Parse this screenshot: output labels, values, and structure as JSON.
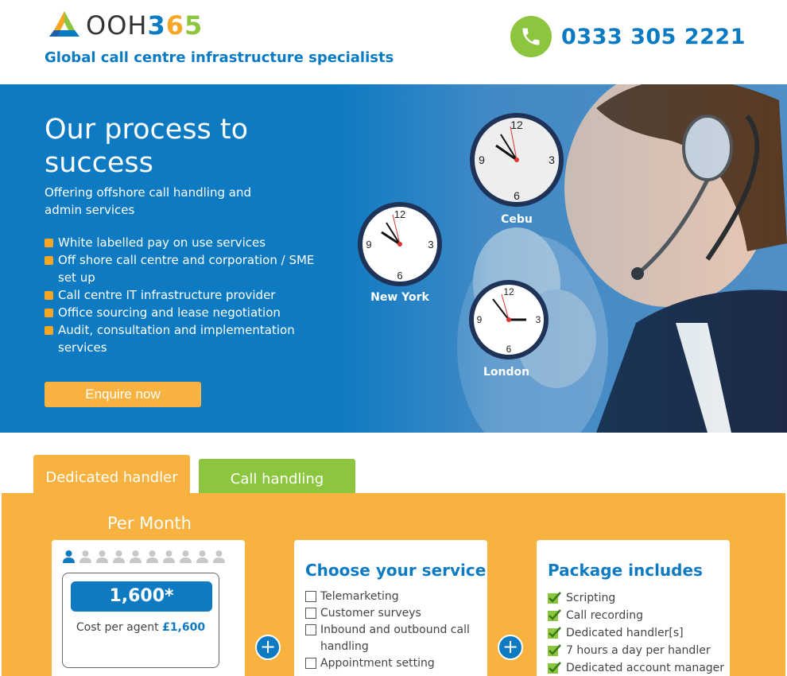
{
  "header": {
    "logo_text_a": "OOH",
    "logo_text_b": "3",
    "logo_text_c": "6",
    "logo_text_d": "5",
    "tagline": "Global call centre infrastructure specialists",
    "phone_icon": "phone-icon",
    "phone_number": "0333 305 2221"
  },
  "hero": {
    "title": "Our process to success",
    "subtitle": "Offering offshore call handling and admin services",
    "bullets": [
      "White labelled pay on use services",
      "Off shore call centre and corporation / SME set up",
      "Call centre IT infrastructure provider",
      "Office sourcing and lease negotiation",
      "Audit, consultation and implementation services"
    ],
    "cta_label": "Enquire now",
    "clocks": [
      {
        "city": "Cebu",
        "n12": "12",
        "n3": "3",
        "n6": "6",
        "n9": "9"
      },
      {
        "city": "New York",
        "n12": "12",
        "n3": "3",
        "n6": "6",
        "n9": "9"
      },
      {
        "city": "London",
        "n12": "12",
        "n3": "3",
        "n6": "6",
        "n9": "9"
      }
    ]
  },
  "tabs": [
    {
      "label": "Dedicated handler",
      "active": true
    },
    {
      "label": "Call handling",
      "active": false
    }
  ],
  "pricing": {
    "per_month_label": "Per Month",
    "agents_selected": 1,
    "agents_total": 10,
    "price_value": "1,600*",
    "cost_label": "Cost per agent",
    "cost_amount": "£1,600",
    "plus_symbol": "+",
    "service_heading": "Choose your service",
    "services": [
      "Telemarketing",
      "Customer surveys",
      "Inbound and outbound call handling",
      "Appointment setting"
    ],
    "package_heading": "Package includes",
    "package_items": [
      "Scripting",
      "Call recording",
      "Dedicated handler[s]",
      "7 hours a day per handler",
      "Dedicated account manager"
    ]
  },
  "colors": {
    "brand_blue": "#0d7ac2",
    "brand_orange": "#f7b240",
    "brand_green": "#8cc63f"
  }
}
